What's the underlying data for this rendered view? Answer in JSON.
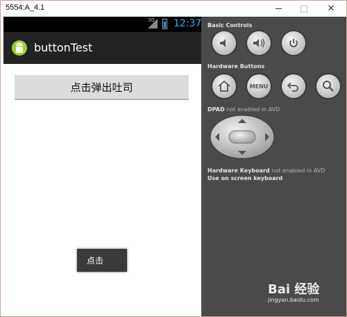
{
  "window": {
    "title": "5554:A_4.1"
  },
  "phone": {
    "statusbar": {
      "network": "3G",
      "clock": "12:37"
    },
    "actionbar": {
      "app_title": "buttonTest"
    },
    "main_button": {
      "label": "点击弹出吐司"
    },
    "toast": {
      "text": "点击"
    }
  },
  "controls": {
    "basic_controls_title": "Basic Controls",
    "hardware_buttons_title": "Hardware Buttons",
    "menu_label": "MENU",
    "dpad_title": "DPAD",
    "dpad_note": "not enabled in AVD",
    "keyboard_title": "Hardware Keyboard",
    "keyboard_note": "not enabled in AVD",
    "onscreen_keyboard": "Use on screen keyboard"
  },
  "watermark": {
    "logo": "Bai 经验",
    "url": "jingyan.baidu.com"
  },
  "colors": {
    "status_accent": "#33b5e5",
    "panel_bg": "#4a4a4a",
    "actionbar_bg": "#222222"
  }
}
